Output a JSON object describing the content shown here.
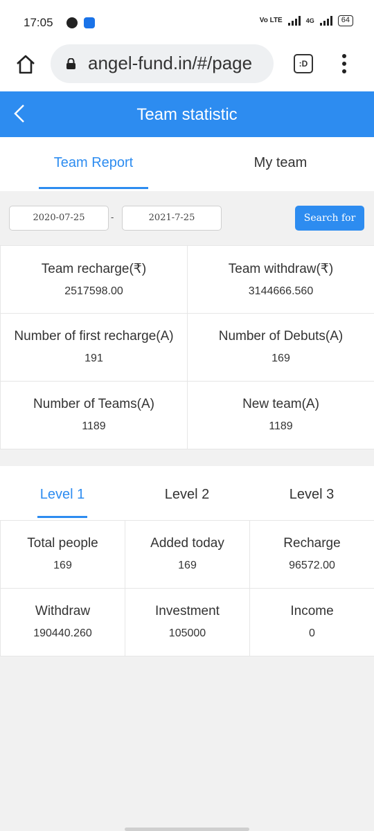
{
  "status_bar": {
    "time": "17:05",
    "volte": "Vo LTE",
    "network": "4G",
    "battery": "64"
  },
  "browser": {
    "url": "angel-fund.in/#/page",
    "tab_label": ":D"
  },
  "header": {
    "title": "Team statistic"
  },
  "top_tabs": [
    {
      "label": "Team Report",
      "active": true
    },
    {
      "label": "My team",
      "active": false
    }
  ],
  "filter": {
    "start_date": "2020-07-25",
    "separator": "-",
    "end_date": "2021-7-25",
    "search_label": "Search for"
  },
  "team_stats": [
    {
      "label": "Team recharge(₹)",
      "value": "2517598.00"
    },
    {
      "label": "Team withdraw(₹)",
      "value": "3144666.560"
    },
    {
      "label": "Number of first recharge(A)",
      "value": "191"
    },
    {
      "label": "Number of Debuts(A)",
      "value": "169"
    },
    {
      "label": "Number of Teams(A)",
      "value": "1189"
    },
    {
      "label": "New team(A)",
      "value": "1189"
    }
  ],
  "level_tabs": [
    {
      "label": "Level 1",
      "active": true
    },
    {
      "label": "Level 2",
      "active": false
    },
    {
      "label": "Level 3",
      "active": false
    }
  ],
  "level_stats": [
    {
      "label": "Total people",
      "value": "169"
    },
    {
      "label": "Added today",
      "value": "169"
    },
    {
      "label": "Recharge",
      "value": "96572.00"
    },
    {
      "label": "Withdraw",
      "value": "190440.260"
    },
    {
      "label": "Investment",
      "value": "105000"
    },
    {
      "label": "Income",
      "value": "0"
    }
  ],
  "colors": {
    "accent": "#2d8cf0",
    "background": "#f1f1f1"
  }
}
